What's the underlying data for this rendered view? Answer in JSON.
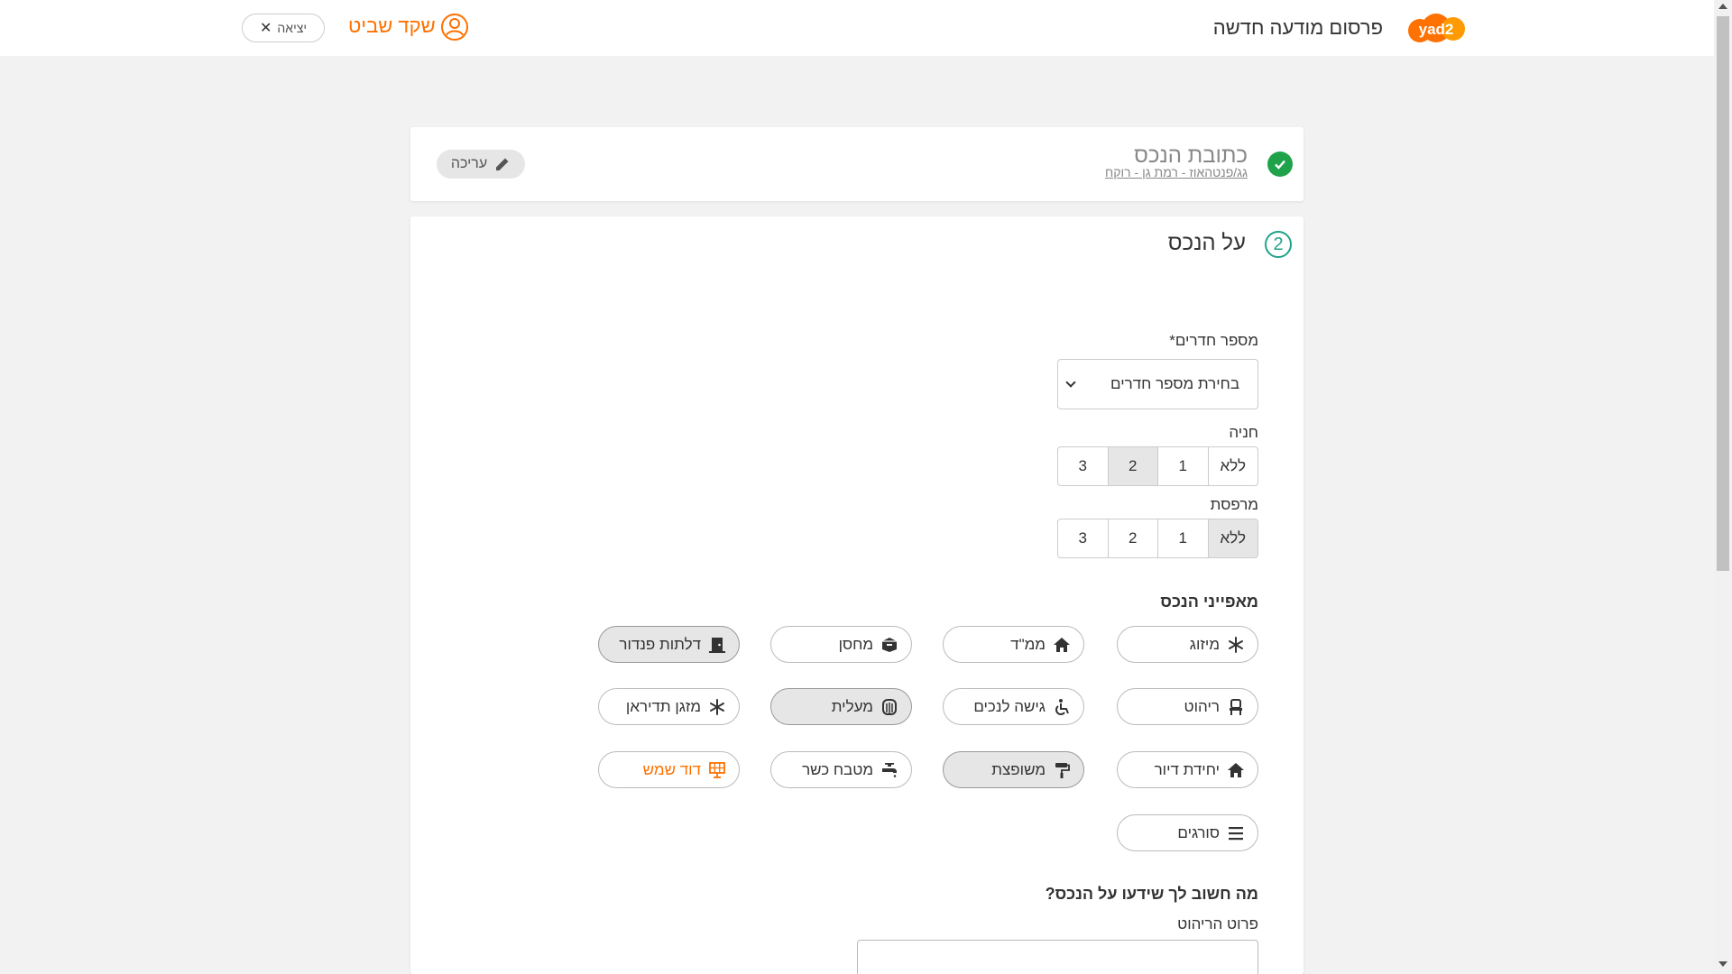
{
  "header": {
    "logo_text": "yad2",
    "title": "פרסום מודעה חדשה",
    "user_name": "שקד שביט",
    "exit_label": "יציאה"
  },
  "address": {
    "title": "כתובת הנכס",
    "value": "גג/פנטהאוז - רמת גן - רוקח",
    "edit_label": "עריכה"
  },
  "property": {
    "step": "2",
    "title": "על הנכס",
    "rooms": {
      "label": "מספר חדרים*",
      "placeholder": "בחירת מספר חדרים"
    },
    "parking": {
      "label": "חניה",
      "options": [
        "ללא",
        "1",
        "2",
        "3"
      ],
      "selected": "2"
    },
    "balcony": {
      "label": "מרפסת",
      "options": [
        "ללא",
        "1",
        "2",
        "3"
      ],
      "selected": "ללא"
    },
    "features_title": "מאפייני הנכס",
    "features": [
      {
        "label": "מיזוג",
        "icon": "snowflake-icon",
        "selected": false
      },
      {
        "label": "ממ\"ד",
        "icon": "home-icon",
        "selected": false
      },
      {
        "label": "מחסן",
        "icon": "box-icon",
        "selected": false
      },
      {
        "label": "דלתות פנדור",
        "icon": "door-icon",
        "selected": true
      },
      {
        "label": "ריהוט",
        "icon": "chair-icon",
        "selected": false
      },
      {
        "label": "גישה לנכים",
        "icon": "wheelchair-icon",
        "selected": false
      },
      {
        "label": "מעלית",
        "icon": "elevator-icon",
        "selected": true
      },
      {
        "label": "מזגן תדיראן",
        "icon": "snowflake-icon",
        "selected": false
      },
      {
        "label": "יחידת דיור",
        "icon": "home-icon",
        "selected": false
      },
      {
        "label": "משופצת",
        "icon": "paint-roller-icon",
        "selected": true
      },
      {
        "label": "מטבח כשר",
        "icon": "faucet-icon",
        "selected": false
      },
      {
        "label": "דוד שמש",
        "icon": "solar-panel-icon",
        "selected": false,
        "accent": true
      },
      {
        "label": "סורגים",
        "icon": "bars-icon",
        "selected": false
      }
    ],
    "important_title": "מה חשוב לך שידעו על הנכס?",
    "furniture_label": "פרוט הריהוט"
  },
  "colors": {
    "accent": "#ff7100",
    "success": "#1fa34a",
    "step": "#1fa38a"
  }
}
